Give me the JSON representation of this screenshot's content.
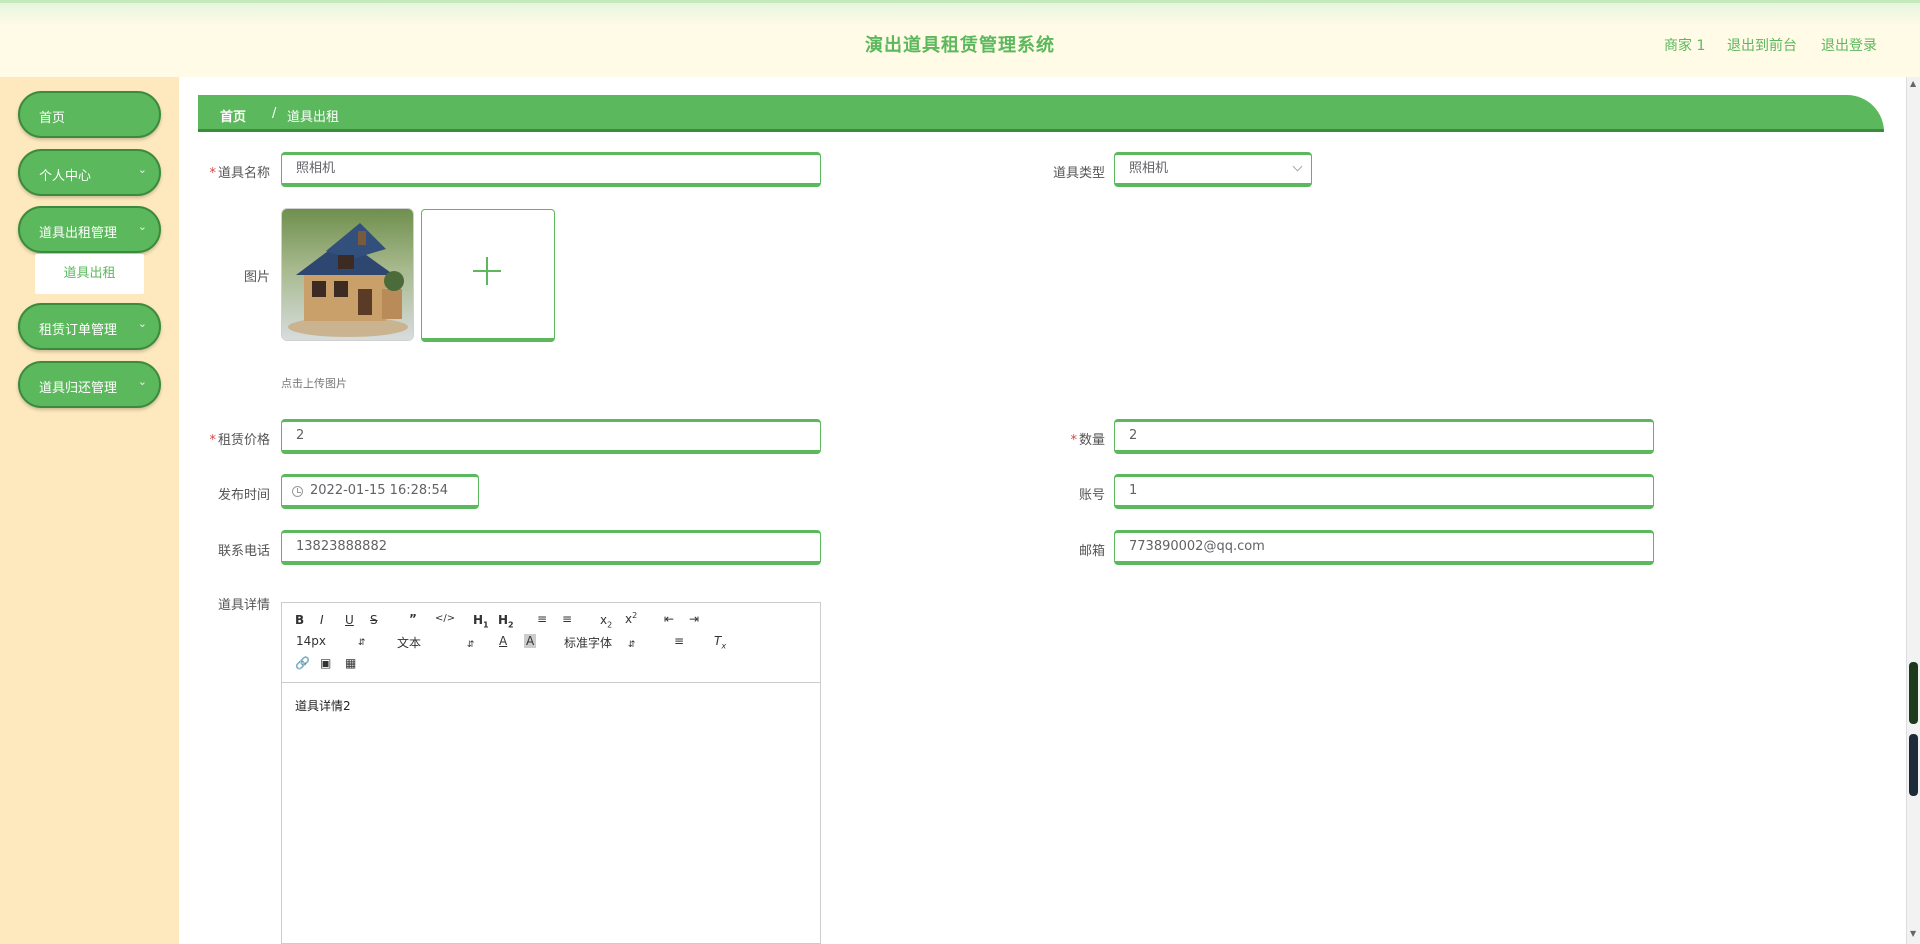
{
  "header": {
    "title": "演出道具租赁管理系统",
    "user": "商家 1",
    "to_front": "退出到前台",
    "logout": "退出登录"
  },
  "sidebar": {
    "items": [
      {
        "label": "首页"
      },
      {
        "label": "个人中心"
      },
      {
        "label": "道具出租管理"
      },
      {
        "label": "租赁订单管理"
      },
      {
        "label": "道具归还管理"
      }
    ],
    "subitem": "道具出租"
  },
  "breadcrumb": {
    "home": "首页",
    "separator": "/",
    "current": "道具出租"
  },
  "form": {
    "name": {
      "label": "道具名称",
      "value": "照相机"
    },
    "type": {
      "label": "道具类型",
      "value": "照相机"
    },
    "image": {
      "label": "图片",
      "hint": "点击上传图片"
    },
    "price": {
      "label": "租赁价格",
      "value": "2"
    },
    "quantity": {
      "label": "数量",
      "value": "2"
    },
    "publish_time": {
      "label": "发布时间",
      "value": "2022-01-15 16:28:54"
    },
    "account": {
      "label": "账号",
      "value": "1"
    },
    "phone": {
      "label": "联系电话",
      "value": "13823888882"
    },
    "email": {
      "label": "邮箱",
      "value": "773890002@qq.com"
    },
    "detail": {
      "label": "道具详情"
    }
  },
  "editor": {
    "font_size": "14px",
    "block_type": "文本",
    "font_family": "标准字体",
    "content": "道具详情2"
  },
  "colors": {
    "accent": "#5cb85c",
    "accent_dark": "#3c8a3c",
    "sidebar_bg": "#fde9bd",
    "required": "#e04040"
  }
}
